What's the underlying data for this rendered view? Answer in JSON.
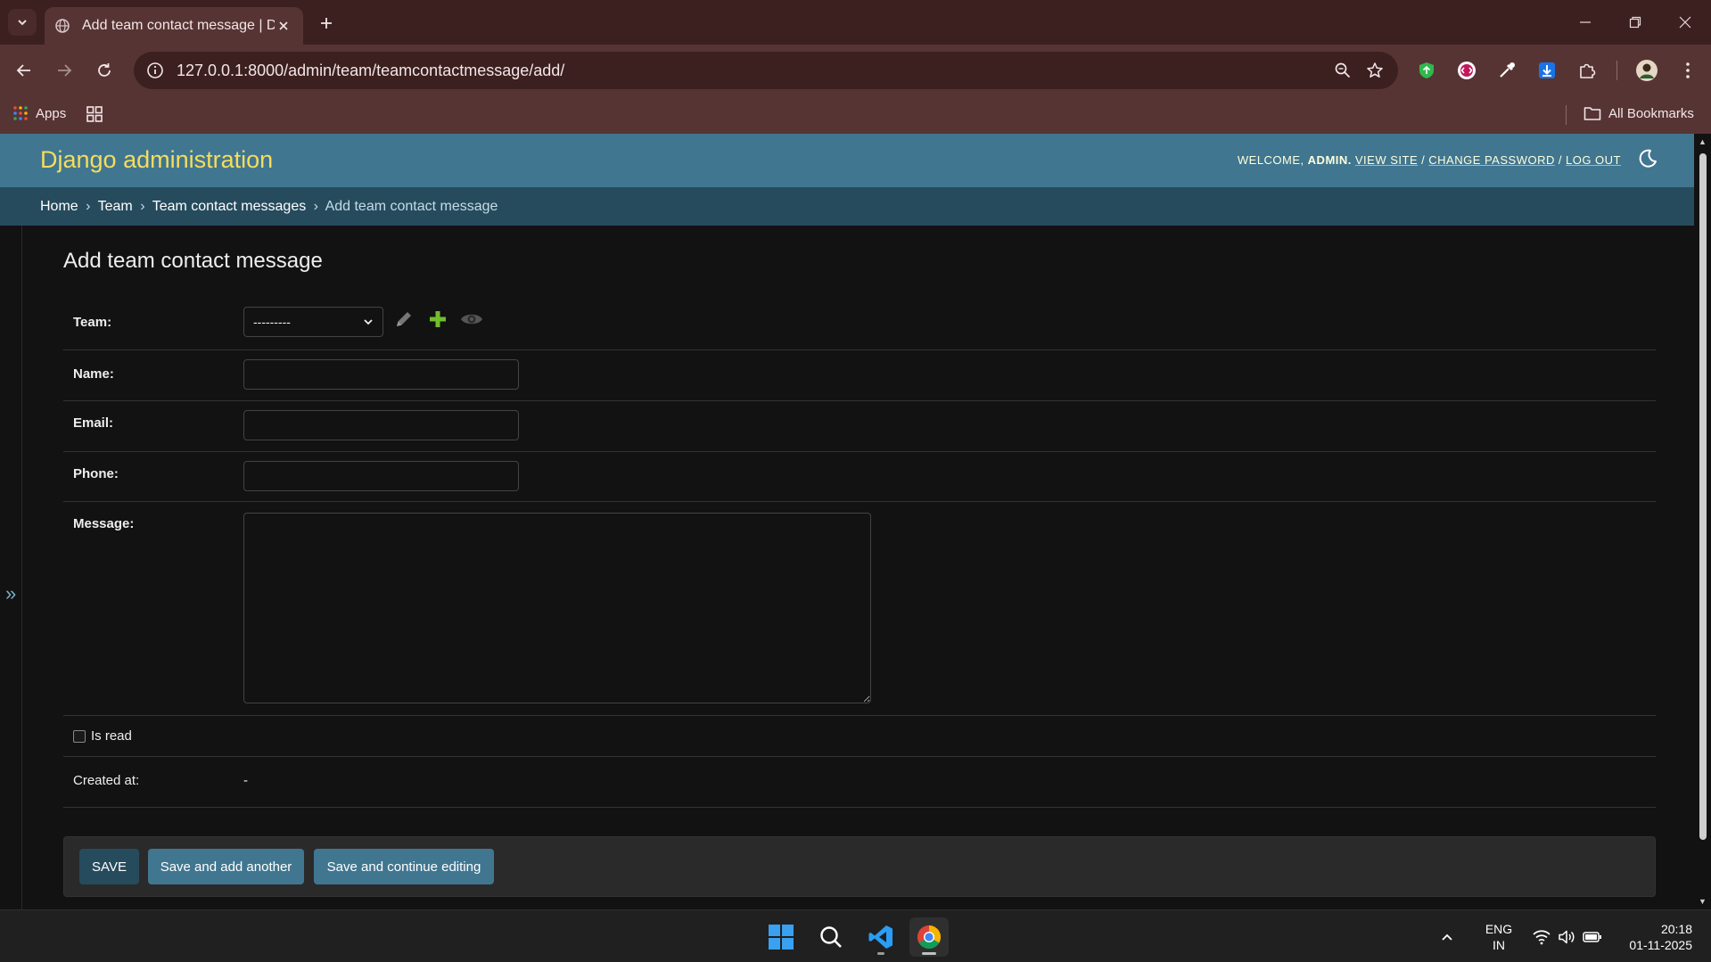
{
  "browser": {
    "tab_title": "Add team contact message | Dj",
    "url": "127.0.0.1:8000/admin/team/teamcontactmessage/add/",
    "bookmarks": {
      "apps_label": "Apps",
      "all_bookmarks_label": "All Bookmarks"
    }
  },
  "header": {
    "branding": "Django administration",
    "welcome": "WELCOME,",
    "username": "ADMIN.",
    "view_site": "VIEW SITE",
    "separator": "/",
    "change_password": "CHANGE PASSWORD",
    "log_out": "LOG OUT"
  },
  "breadcrumbs": {
    "items": [
      "Home",
      "Team",
      "Team contact messages",
      "Add team contact message"
    ],
    "separator": "›"
  },
  "sidebar": {
    "toggle_label": "»"
  },
  "form": {
    "title": "Add team contact message",
    "team": {
      "label": "Team:",
      "selected": "---------"
    },
    "name": {
      "label": "Name:",
      "value": ""
    },
    "email": {
      "label": "Email:",
      "value": ""
    },
    "phone": {
      "label": "Phone:",
      "value": ""
    },
    "message": {
      "label": "Message:",
      "value": ""
    },
    "is_read": {
      "label": "Is read",
      "checked": false
    },
    "created_at": {
      "label": "Created at:",
      "value": "-"
    }
  },
  "submit": {
    "save": "SAVE",
    "save_add_another": "Save and add another",
    "save_continue": "Save and continue editing"
  },
  "taskbar": {
    "language": "ENG",
    "region": "IN",
    "time": "20:18",
    "date": "01-11-2025"
  },
  "colors": {
    "header_bg": "#417690",
    "branding": "#f5dd5d",
    "breadcrumbs_bg": "#264b5d",
    "page_bg": "#121212",
    "add_icon": "#70bf2b"
  }
}
